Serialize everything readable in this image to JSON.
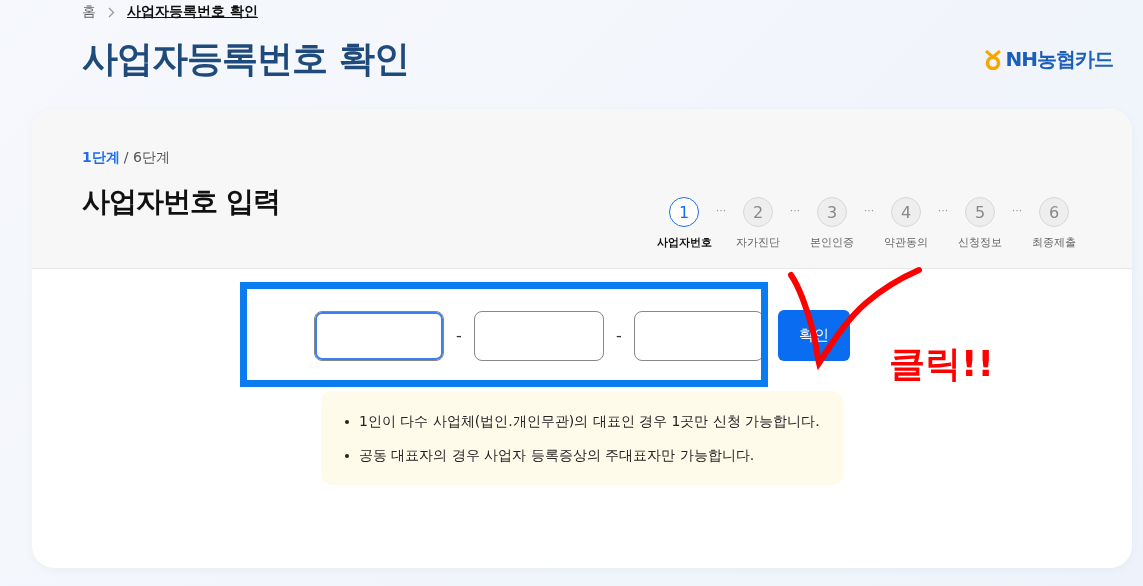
{
  "breadcrumb": [
    {
      "label": "홈",
      "current": false
    },
    {
      "label": "사업자등록번호 확인",
      "current": true
    }
  ],
  "title": "사업자등록번호 확인",
  "logo": {
    "text": "NH농협카드"
  },
  "progress": {
    "current": "1단계",
    "total": "/ 6단계"
  },
  "section_title": "사업자번호 입력",
  "steps": [
    {
      "number": "1",
      "label": "사업자번호",
      "selected": true
    },
    {
      "number": "2",
      "label": "자가진단",
      "selected": false
    },
    {
      "number": "3",
      "label": "본인인증",
      "selected": false
    },
    {
      "number": "4",
      "label": "약관동의",
      "selected": false
    },
    {
      "number": "5",
      "label": "신청정보",
      "selected": false
    },
    {
      "number": "6",
      "label": "최종제출",
      "selected": false
    }
  ],
  "step_separator": "···",
  "inputs": [
    {
      "focused": true
    },
    {
      "focused": false
    },
    {
      "focused": false
    }
  ],
  "input_separator": "-",
  "confirm_button": "확인",
  "notes": [
    "1인이 다수 사업체(법인.개인무관)의 대표인 경우 1곳만 신청 가능합니다.",
    "공동 대표자의 경우 사업자 등록증상의 주대표자만 가능합니다."
  ],
  "annotation": {
    "text": "클릭!!"
  }
}
